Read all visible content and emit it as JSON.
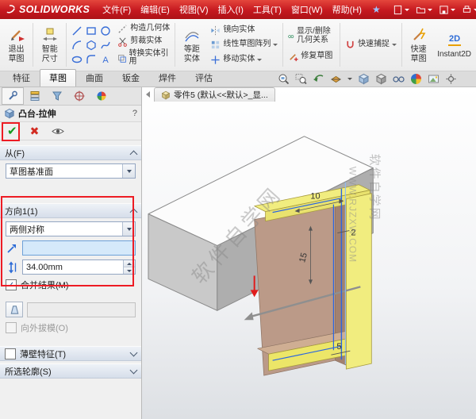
{
  "titlebar": {
    "brand": "SOLIDWORKS",
    "menus": [
      "文件(F)",
      "编辑(E)",
      "视图(V)",
      "插入(I)",
      "工具(T)",
      "窗口(W)",
      "帮助(H)"
    ]
  },
  "ribbon": {
    "exit_sketch": "退出草图",
    "smart_dimension": "智能尺寸",
    "construction_geometry": "构造几何体",
    "trim_entities": "剪裁实体",
    "convert_entities": "转换实体引用",
    "offset_entities": "等距实体",
    "mirror_entities": "镜向实体",
    "linear_sketch_pattern": "线性草图阵列",
    "move_entities": "移动实体",
    "display_delete_relations": "显示/删除几何关系",
    "repair_sketch": "修复草图",
    "quick_snaps": "快速捕捉",
    "rapid_sketch": "快速草图",
    "instant2d": "Instant2D",
    "tabs": [
      "特征",
      "草图",
      "曲面",
      "钣金",
      "焊件",
      "评估"
    ]
  },
  "panel": {
    "title": "凸台-拉伸",
    "help": "?",
    "from_label": "从(F)",
    "from_value": "草图基准面",
    "dir1_label": "方向1(1)",
    "dir1_end_condition": "两侧对称",
    "depth_value": "34.00mm",
    "merge_result_label": "合并结果(M)",
    "draft_outward_label": "向外拔模(O)",
    "thin_feature_label": "薄壁特征(T)",
    "selected_contours_label": "所选轮廓(S)"
  },
  "viewport": {
    "doc_tab": "零件5 (默认<<默认>_显...",
    "dims": {
      "top_width": "10",
      "thickness": "2",
      "height": "15",
      "bottom_width": "5"
    },
    "watermark_text": "软件自学网",
    "watermark_url": "WWW.RJZXW.COM"
  }
}
